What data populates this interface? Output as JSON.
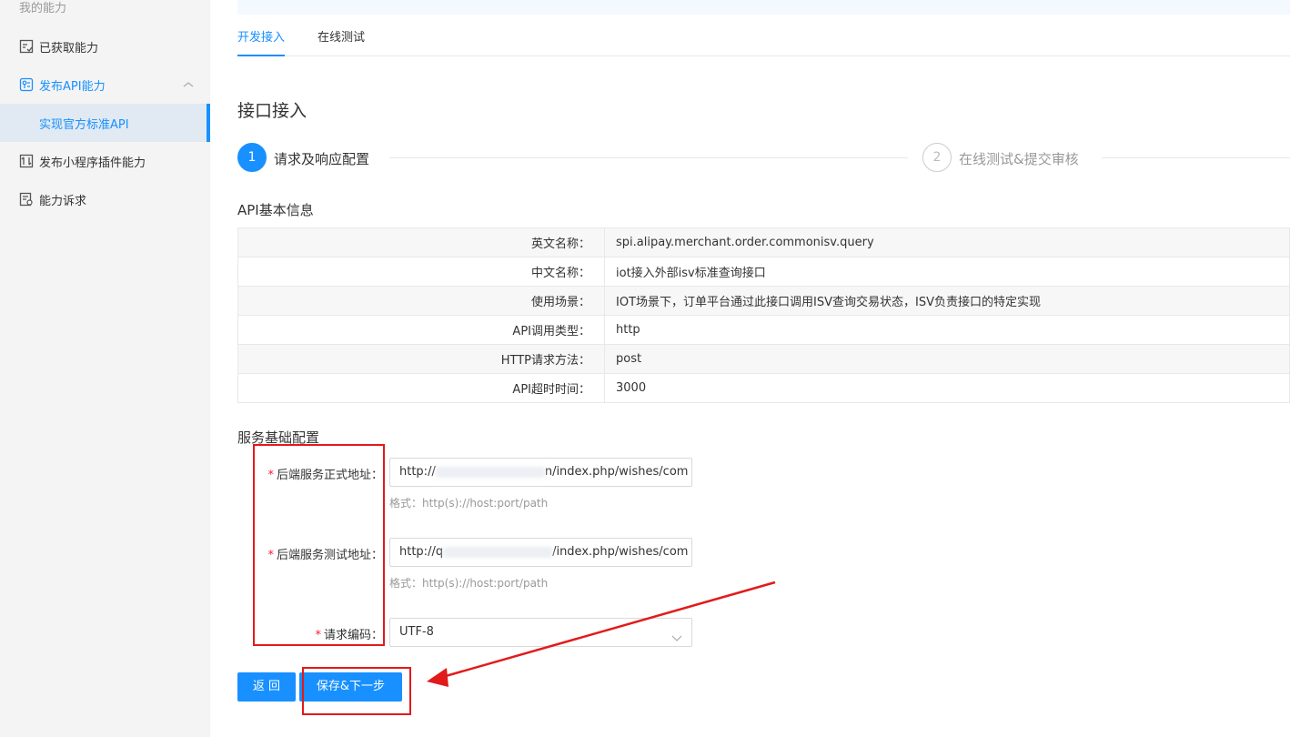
{
  "sidebar": {
    "section_title": "我的能力",
    "items": [
      {
        "label": "已获取能力",
        "icon": "list-icon"
      },
      {
        "label": "发布API能力",
        "icon": "api-icon"
      },
      {
        "label": "实现官方标准API"
      },
      {
        "label": "发布小程序插件能力",
        "icon": "plugin-icon"
      },
      {
        "label": "能力诉求",
        "icon": "request-icon"
      }
    ]
  },
  "tabs": [
    {
      "label": "开发接入",
      "active": true
    },
    {
      "label": "在线测试",
      "active": false
    }
  ],
  "page_title": "接口接入",
  "steps": [
    {
      "number": "1",
      "label": "请求及响应配置",
      "active": true
    },
    {
      "number": "2",
      "label": "在线测试&提交审核",
      "active": false
    }
  ],
  "api_info": {
    "title": "API基本信息",
    "rows": [
      {
        "key": "英文名称：",
        "value": "spi.alipay.merchant.order.commonisv.query"
      },
      {
        "key": "中文名称：",
        "value": "iot接入外部isv标准查询接口"
      },
      {
        "key": "使用场景：",
        "value": "IOT场景下，订单平台通过此接口调用ISV查询交易状态，ISV负责接口的特定实现"
      },
      {
        "key": "API调用类型：",
        "value": "http"
      },
      {
        "key": "HTTP请求方法：",
        "value": "post"
      },
      {
        "key": "API超时时间：",
        "value": "3000"
      }
    ]
  },
  "service_config": {
    "title": "服务基础配置",
    "required_mark": "*",
    "prod_address": {
      "label": "后端服务正式地址：",
      "value_prefix": "http://",
      "value_suffix": "n/index.php/wishes/com",
      "hint": "格式：http(s)://host:port/path"
    },
    "test_address": {
      "label": "后端服务测试地址：",
      "value_prefix": "http://q",
      "value_suffix": "/index.php/wishes/com",
      "hint": "格式：http(s)://host:port/path"
    },
    "encoding": {
      "label": "请求编码：",
      "value": "UTF-8"
    }
  },
  "buttons": {
    "back": "返 回",
    "save_next": "保存&下一步"
  },
  "colors": {
    "primary": "#1890ff",
    "annotation": "#e21a1a",
    "required": "#f5222d"
  }
}
